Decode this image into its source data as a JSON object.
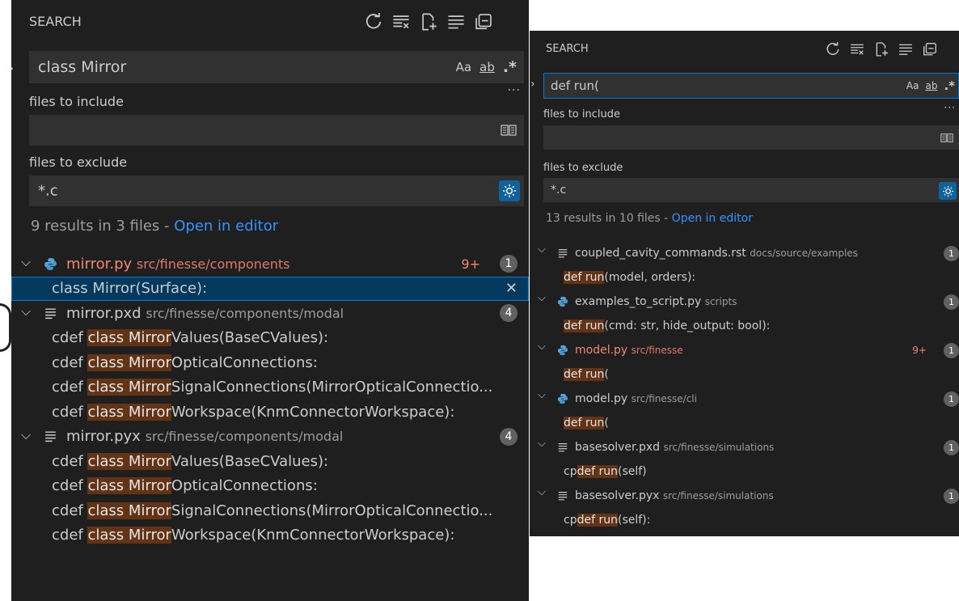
{
  "left": {
    "header": {
      "title": "SEARCH"
    },
    "search": {
      "value": "class Mirror"
    },
    "options": {
      "case": "Aa",
      "word": "ab",
      "regex": ".*"
    },
    "more": "···",
    "include": {
      "label": "files to include",
      "value": ""
    },
    "exclude": {
      "label": "files to exclude",
      "value": "*.c"
    },
    "summary": {
      "text": "9 results in 3 files - ",
      "link": "Open in editor"
    },
    "files": [
      {
        "name": "mirror.py",
        "path": "src/finesse/components",
        "modified": true,
        "warn": "9+",
        "count": "1",
        "icon": "python-icon",
        "matches": [
          {
            "pre": "",
            "hit": "class Mirror",
            "post": "(Surface):",
            "selected": true
          }
        ]
      },
      {
        "name": "mirror.pxd",
        "path": "src/finesse/components/modal",
        "modified": false,
        "count": "4",
        "icon": "text-file-icon",
        "matches": [
          {
            "pre": "cdef ",
            "hit": "class Mirror",
            "post": "Values(BaseCValues):"
          },
          {
            "pre": "cdef ",
            "hit": "class Mirror",
            "post": "OpticalConnections:"
          },
          {
            "pre": "cdef ",
            "hit": "class Mirror",
            "post": "SignalConnections(MirrorOpticalConnectio..."
          },
          {
            "pre": "cdef ",
            "hit": "class Mirror",
            "post": "Workspace(KnmConnectorWorkspace):"
          }
        ]
      },
      {
        "name": "mirror.pyx",
        "path": "src/finesse/components/modal",
        "modified": false,
        "count": "4",
        "icon": "text-file-icon",
        "matches": [
          {
            "pre": "cdef ",
            "hit": "class Mirror",
            "post": "Values(BaseCValues):"
          },
          {
            "pre": "cdef ",
            "hit": "class Mirror",
            "post": "OpticalConnections:"
          },
          {
            "pre": "cdef ",
            "hit": "class Mirror",
            "post": "SignalConnections(MirrorOpticalConnectio..."
          },
          {
            "pre": "cdef ",
            "hit": "class Mirror",
            "post": "Workspace(KnmConnectorWorkspace):"
          }
        ]
      }
    ]
  },
  "right": {
    "header": {
      "title": "SEARCH"
    },
    "search": {
      "value": "def run("
    },
    "options": {
      "case": "Aa",
      "word": "ab",
      "regex": ".*"
    },
    "more": "···",
    "include": {
      "label": "files to include",
      "value": ""
    },
    "exclude": {
      "label": "files to exclude",
      "value": "*.c"
    },
    "summary": {
      "text": "13 results in 10 files - ",
      "link": "Open in editor"
    },
    "files": [
      {
        "name": "coupled_cavity_commands.rst",
        "path": "docs/source/examples",
        "modified": false,
        "count": "1",
        "icon": "text-file-icon",
        "matches": [
          {
            "pre": "",
            "hit": "def run",
            "post": "(model, orders):"
          }
        ]
      },
      {
        "name": "examples_to_script.py",
        "path": "scripts",
        "modified": false,
        "count": "1",
        "icon": "python-icon",
        "matches": [
          {
            "pre": "",
            "hit": "def run",
            "post": "(cmd: str, hide_output: bool):"
          }
        ]
      },
      {
        "name": "model.py",
        "path": "src/finesse",
        "modified": true,
        "warn": "9+",
        "count": "1",
        "icon": "python-icon",
        "matches": [
          {
            "pre": "",
            "hit": "def run",
            "post": "("
          }
        ]
      },
      {
        "name": "model.py",
        "path": "src/finesse/cli",
        "modified": false,
        "count": "1",
        "icon": "python-icon",
        "matches": [
          {
            "pre": "",
            "hit": "def run",
            "post": "("
          }
        ]
      },
      {
        "name": "basesolver.pxd",
        "path": "src/finesse/simulations",
        "modified": false,
        "count": "1",
        "icon": "text-file-icon",
        "matches": [
          {
            "pre": "cp",
            "hit": "def run",
            "post": "(self)"
          }
        ]
      },
      {
        "name": "basesolver.pyx",
        "path": "src/finesse/simulations",
        "modified": false,
        "count": "1",
        "icon": "text-file-icon",
        "matches": [
          {
            "pre": "cp",
            "hit": "def run",
            "post": "(self):"
          }
        ]
      }
    ]
  },
  "colors": {
    "panel": "#1f1f1f",
    "input": "#313131",
    "focus": "#0078d4",
    "highlight": "#623315",
    "link": "#3794ff",
    "modified": "#f48771",
    "badge": "#616161"
  }
}
